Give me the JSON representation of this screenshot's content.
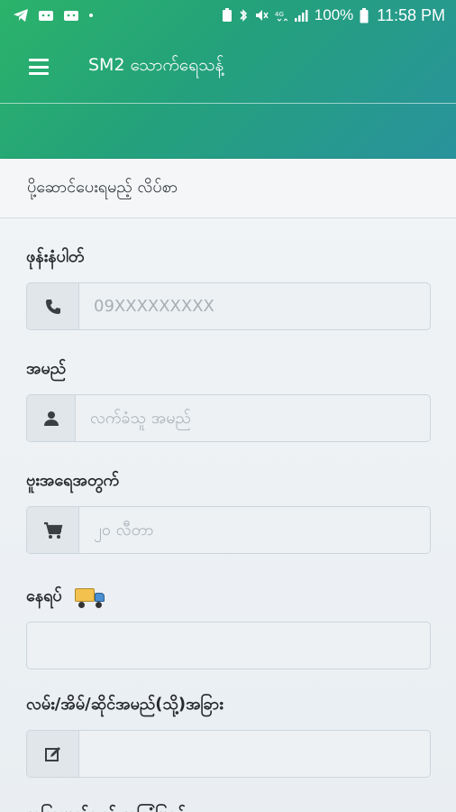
{
  "status_bar": {
    "left_icons": [
      "telegram-icon",
      "android-icon",
      "android-icon",
      "dot-icon"
    ],
    "right_icons": [
      "battery-saver-icon",
      "bluetooth-icon",
      "mute-icon",
      "4g-icon",
      "signal-icon"
    ],
    "battery": "100%",
    "time": "11:58 PM"
  },
  "app_bar": {
    "title": "SM2 သောက်ရေသန့်"
  },
  "card": {
    "header": "ပို့ဆောင်ပေးရမည့် လိပ်စာ"
  },
  "form": {
    "phone": {
      "label": "ဖုန်းနံပါတ်",
      "placeholder": "09XXXXXXXXX",
      "icon": "phone-icon"
    },
    "name": {
      "label": "အမည်",
      "placeholder": "လက်ခံသူ အမည်",
      "icon": "person-icon"
    },
    "order": {
      "label": "ဗူးအရေအတွက်",
      "placeholder": "၂၀ လီတာ",
      "icon": "cart-icon"
    },
    "location": {
      "label": "နေရပ်",
      "icon": "truck-icon",
      "placeholder": ""
    },
    "address": {
      "label": "လမ်း/အိမ်/ဆိုင်အမည်(သို့)အခြား",
      "placeholder": "",
      "icon": "edit-icon"
    },
    "notes": {
      "label": "အခြားမှတ်ချက် အကြံပြုရန်"
    }
  },
  "colors": {
    "gradient_start": "#2bb36a",
    "gradient_end": "#3a6fc9",
    "card_bg": "#f1f4f6"
  }
}
